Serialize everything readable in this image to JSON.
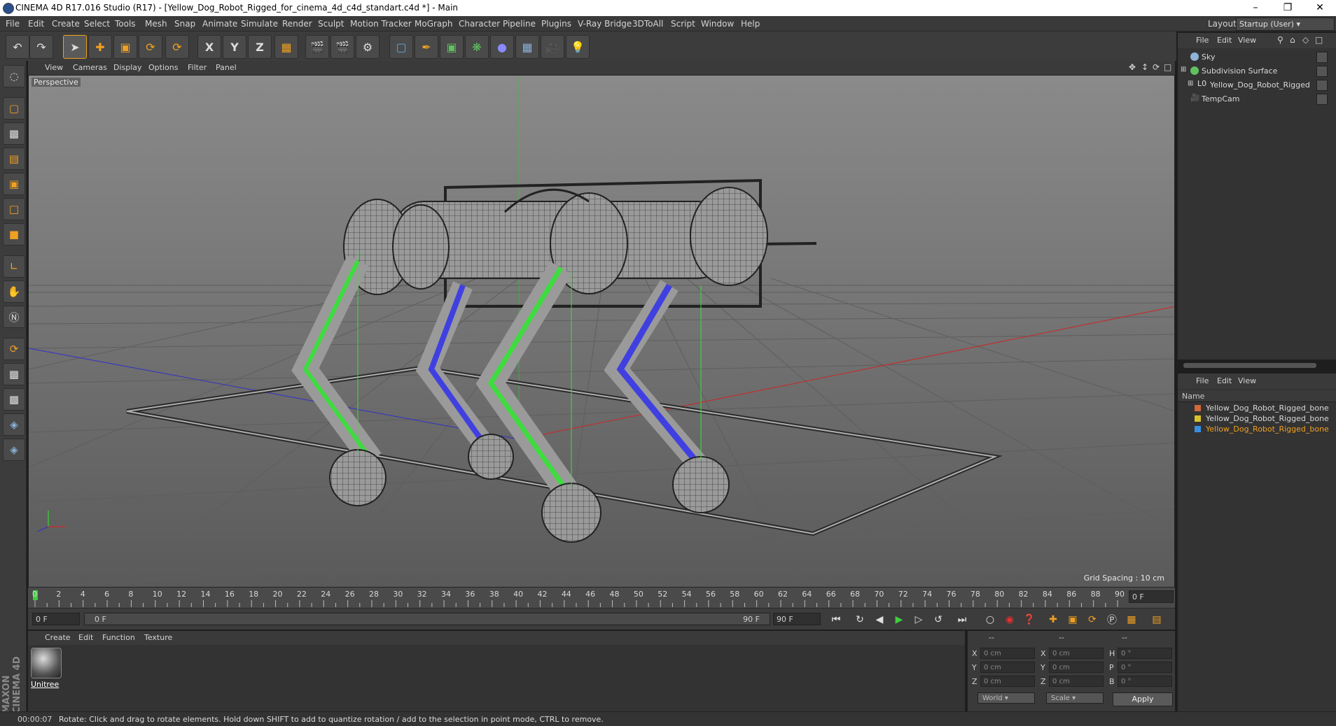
{
  "title": "CINEMA 4D R17.016 Studio (R17) - [Yellow_Dog_Robot_Rigged_for_cinema_4d_c4d_standart.c4d *] - Main",
  "menus": [
    "File",
    "Edit",
    "Create",
    "Select",
    "Tools",
    "Mesh",
    "Snap",
    "Animate",
    "Simulate",
    "Render",
    "Sculpt",
    "Motion Tracker",
    "MoGraph",
    "Character",
    "Pipeline",
    "Plugins",
    "V-Ray Bridge",
    "3DToAll",
    "Script",
    "Window",
    "Help"
  ],
  "layout": {
    "label": "Layout:",
    "value": "Startup (User)"
  },
  "toolbar_icons": [
    "undo-icon",
    "redo-icon",
    "select-icon",
    "move-icon",
    "scale-icon",
    "rotate-icon",
    "recent-icon",
    "x-axis-icon",
    "y-axis-icon",
    "z-axis-icon",
    "world-coord-icon",
    "render-view-icon",
    "render-picture-viewer-icon",
    "edit-render-settings-icon",
    "cube-icon",
    "pen-icon",
    "subdivision-icon",
    "mograph-icon",
    "deformer-icon",
    "floor-icon",
    "camera-icon",
    "light-icon"
  ],
  "toolbar_glyphs": {
    "x": "X",
    "y": "Y",
    "z": "Z"
  },
  "viewport": {
    "menus": [
      "View",
      "Cameras",
      "Display",
      "Options",
      "Filter",
      "Panel"
    ],
    "label": "Perspective",
    "grid_spacing": "Grid Spacing : 10 cm"
  },
  "timeline": {
    "ticks": [
      "0",
      "2",
      "4",
      "6",
      "8",
      "10",
      "12",
      "14",
      "16",
      "18",
      "20",
      "22",
      "24",
      "26",
      "28",
      "30",
      "32",
      "34",
      "36",
      "38",
      "40",
      "42",
      "44",
      "46",
      "48",
      "50",
      "52",
      "54",
      "56",
      "58",
      "60",
      "62",
      "64",
      "66",
      "68",
      "70",
      "72",
      "74",
      "76",
      "78",
      "80",
      "82",
      "84",
      "86",
      "88",
      "90"
    ],
    "current_frame": "0 F"
  },
  "transport": {
    "start": "0 F",
    "range_start": "0 F",
    "range_end": "90 F",
    "end": "90 F"
  },
  "material": {
    "menus": [
      "Create",
      "Edit",
      "Function",
      "Texture"
    ],
    "item": "Unitree"
  },
  "coords": {
    "header": [
      "--",
      "--",
      "--"
    ],
    "rows": [
      {
        "a": "X",
        "pos": "0 cm",
        "b": "X",
        "size": "0 cm",
        "c": "H",
        "rot": "0 °"
      },
      {
        "a": "Y",
        "pos": "0 cm",
        "b": "Y",
        "size": "0 cm",
        "c": "P",
        "rot": "0 °"
      },
      {
        "a": "Z",
        "pos": "0 cm",
        "b": "Z",
        "size": "0 cm",
        "c": "B",
        "rot": "0 °"
      }
    ],
    "mode1": "World",
    "mode2": "Scale",
    "apply": "Apply"
  },
  "status": {
    "time": "00:00:07",
    "text": "Rotate: Click and drag to rotate elements. Hold down SHIFT to add to quantize rotation / add to the selection in point mode, CTRL to remove."
  },
  "object_manager": {
    "menus": [
      "File",
      "Edit",
      "View"
    ],
    "objects": [
      {
        "name": "Sky",
        "icon": "sky-icon",
        "color": "#8fb2d6"
      },
      {
        "name": "Subdivision Surface",
        "icon": "subdivision-icon",
        "color": "#5fc25f"
      },
      {
        "name": "Yellow_Dog_Robot_Rigged",
        "icon": "null-icon",
        "color": "#c8c8c8"
      },
      {
        "name": "TempCam",
        "icon": "camera-icon",
        "color": "#c8c8c8"
      }
    ]
  },
  "layer_manager": {
    "menus": [
      "File",
      "Edit",
      "View"
    ],
    "column": "Name",
    "layers": [
      {
        "name": "Yellow_Dog_Robot_Rigged_bone",
        "color": "#d4683a",
        "active": false
      },
      {
        "name": "Yellow_Dog_Robot_Rigged_bone",
        "color": "#d8c22a",
        "active": false
      },
      {
        "name": "Yellow_Dog_Robot_Rigged_bone",
        "color": "#3a8ee0",
        "active": true
      }
    ]
  },
  "colors": {
    "accent": "#f0a020",
    "active_layer_text": "#f0a020",
    "viewport_bg": "#6e6e6e"
  }
}
